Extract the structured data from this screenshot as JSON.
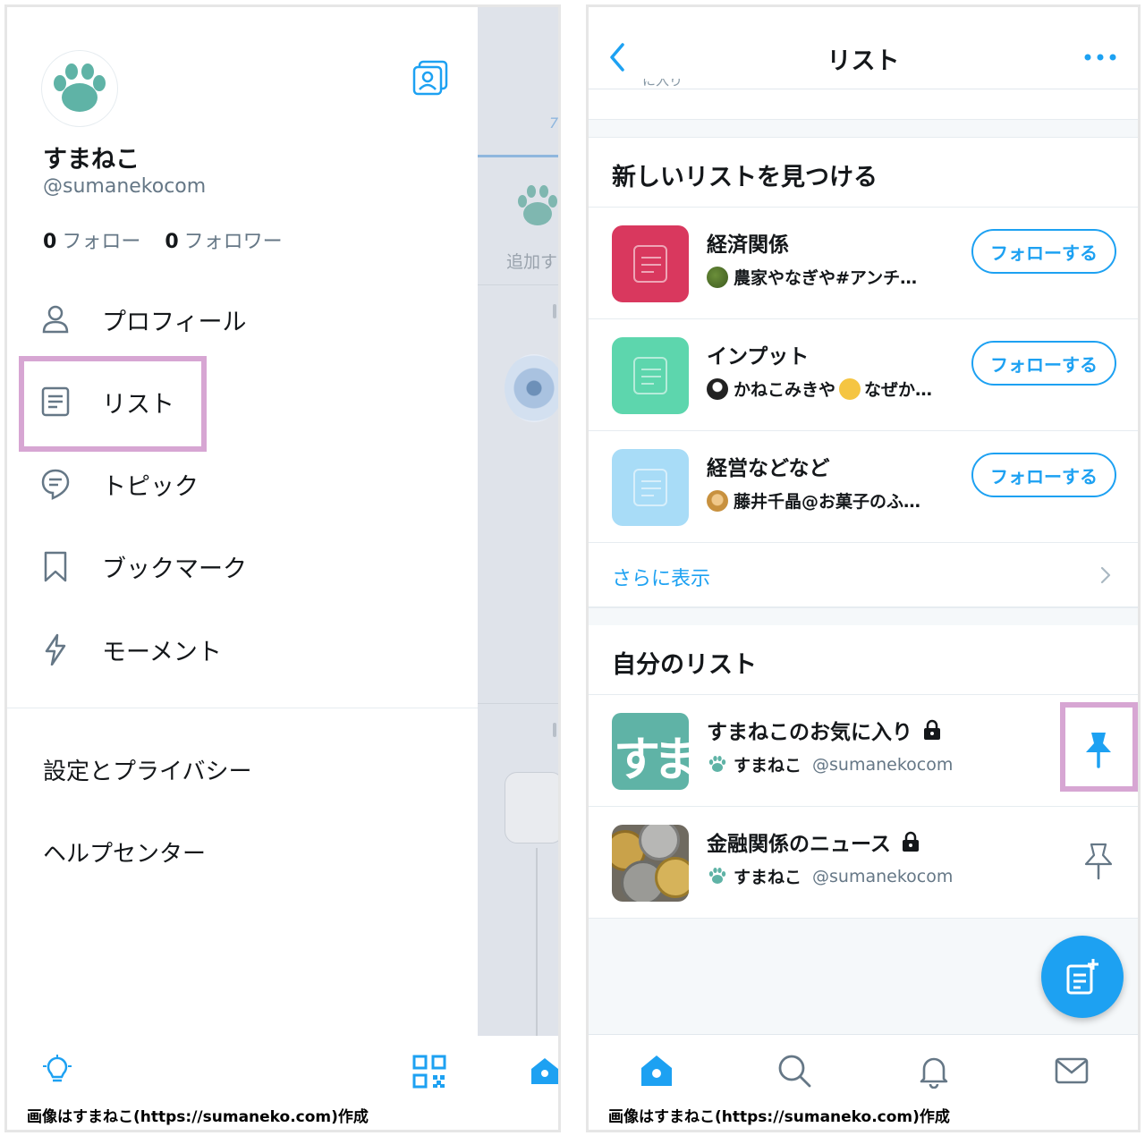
{
  "left": {
    "profile": {
      "display_name": "すまねこ",
      "handle": "@sumanekocom",
      "following_count": "0",
      "following_label": "フォロー",
      "followers_count": "0",
      "followers_label": "フォロワー",
      "avatar_icon": "paw-icon"
    },
    "menu": [
      {
        "label": "プロフィール",
        "icon": "person-icon"
      },
      {
        "label": "リスト",
        "icon": "list-icon"
      },
      {
        "label": "トピック",
        "icon": "topic-icon"
      },
      {
        "label": "ブックマーク",
        "icon": "bookmark-icon"
      },
      {
        "label": "モーメント",
        "icon": "lightning-icon"
      }
    ],
    "settings_label": "設定とプライバシー",
    "help_label": "ヘルプセンター",
    "timeline_add_text": "追加す",
    "credit": "画像はすまねこ(https://sumaneko.com)作成"
  },
  "right": {
    "header": {
      "title": "リスト",
      "clipped_text": "に入り"
    },
    "discover": {
      "title": "新しいリストを見つける",
      "items": [
        {
          "name": "経済関係",
          "owner": "農家やなぎや#アンチ…",
          "follow_label": "フォローする",
          "thumb_color": "#d9385e"
        },
        {
          "name": "インプット",
          "owner_prefix": "かねこみきや",
          "owner_suffix": "なぜか…",
          "follow_label": "フォローする",
          "thumb_color": "#5dd6ad"
        },
        {
          "name": "経営などなど",
          "owner": "藤井千晶@お菓子のふ…",
          "follow_label": "フォローする",
          "thumb_color": "#a8dcf7"
        }
      ],
      "show_more": "さらに表示"
    },
    "my_lists": {
      "title": "自分のリスト",
      "items": [
        {
          "name": "すまねこのお気に入り",
          "owner": "すまねこ",
          "handle": "@sumanekocom",
          "thumb_text": "すま",
          "pinned": true
        },
        {
          "name": "金融関係のニュース",
          "owner": "すまねこ",
          "handle": "@sumanekocom",
          "pinned": false
        }
      ]
    },
    "credit": "画像はすまねこ(https://sumaneko.com)作成"
  },
  "colors": {
    "accent": "#1da1f2",
    "highlight": "#d7a6d3",
    "paw": "#5fb3a6"
  }
}
